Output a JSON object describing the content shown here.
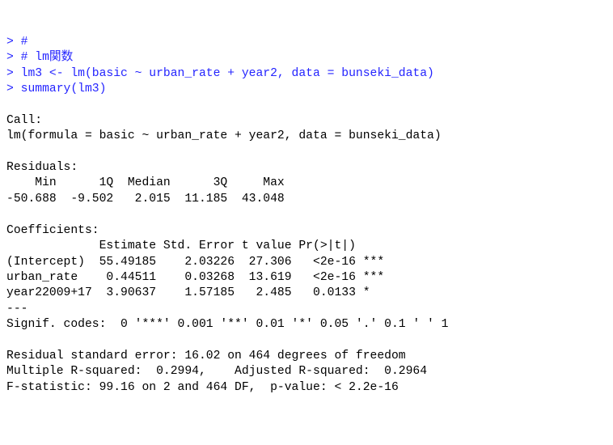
{
  "input": {
    "line1": "> #",
    "line2": "> # lm関数",
    "line3": "> lm3 <- lm(basic ~ urban_rate + year2, data = bunseki_data)",
    "line4": "> summary(lm3)"
  },
  "output": {
    "call_hdr": "Call:",
    "call_body": "lm(formula = basic ~ urban_rate + year2, data = bunseki_data)",
    "resid_hdr": "Residuals:",
    "resid_names": "    Min      1Q  Median      3Q     Max ",
    "resid_vals": "-50.688  -9.502   2.015  11.185  43.048 ",
    "coef_hdr": "Coefficients:",
    "coef_names": "             Estimate Std. Error t value Pr(>|t|)    ",
    "coef_row1": "(Intercept)  55.49185    2.03226  27.306   <2e-16 ***",
    "coef_row2": "urban_rate    0.44511    0.03268  13.619   <2e-16 ***",
    "coef_row3": "year22009+17  3.90637    1.57185   2.485   0.0133 *  ",
    "dashes": "---",
    "signif": "Signif. codes:  0 '***' 0.001 '**' 0.01 '*' 0.05 '.' 0.1 ' ' 1",
    "rse": "Residual standard error: 16.02 on 464 degrees of freedom",
    "r2": "Multiple R-squared:  0.2994,\tAdjusted R-squared:  0.2964 ",
    "fstat": "F-statistic: 99.16 on 2 and 464 DF,  p-value: < 2.2e-16"
  }
}
